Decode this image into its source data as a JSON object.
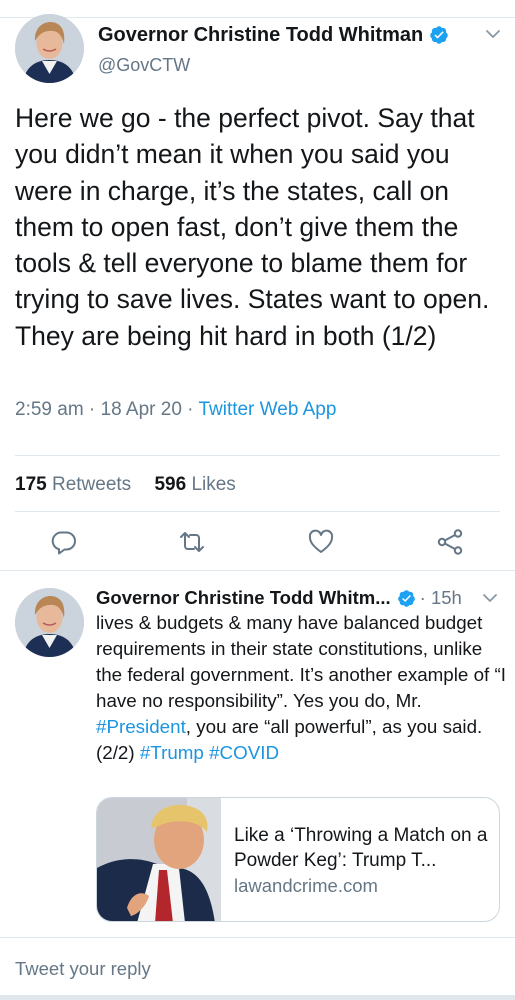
{
  "main_tweet": {
    "name": "Governor Christine Todd Whitman",
    "handle": "@GovCTW",
    "text": "Here we go - the perfect pivot. Say that you didn’t mean it when you said you were in charge, it’s the states, call on them to open fast, don’t give them the tools & tell everyone to blame them for trying to save lives. States want to open.  They are being hit hard in both (1/2)",
    "time": "2:59 am",
    "date": "18 Apr 20",
    "source": "Twitter Web App",
    "separator": " · ",
    "retweets_count": "175",
    "retweets_label": "Retweets",
    "likes_count": "596",
    "likes_label": "Likes",
    "icons": [
      "reply-icon",
      "retweet-icon",
      "like-icon",
      "share-icon"
    ]
  },
  "reply_tweet": {
    "name": "Governor Christine Todd Whitm...",
    "time": "· 15h",
    "text_parts": [
      "lives & budgets & many have balanced budget requirements in their state constitutions, unlike the federal government. It’s another example of “I have no responsibility”.  Yes you do, Mr. ",
      "#President",
      ", you are “all powerful”, as you said. (2/2) ",
      "#Trump",
      " ",
      "#COVID"
    ],
    "card": {
      "title": "Like a ‘Throwing a Match on a Powder Keg’: Trump T...",
      "domain": "lawandcrime.com"
    }
  },
  "reply_bar": {
    "placeholder": "Tweet your reply"
  },
  "colors": {
    "accent": "#1b95e0",
    "verified": "#1da1f2",
    "muted": "#657786",
    "text": "#14171a",
    "divider": "#e1e8ed"
  }
}
